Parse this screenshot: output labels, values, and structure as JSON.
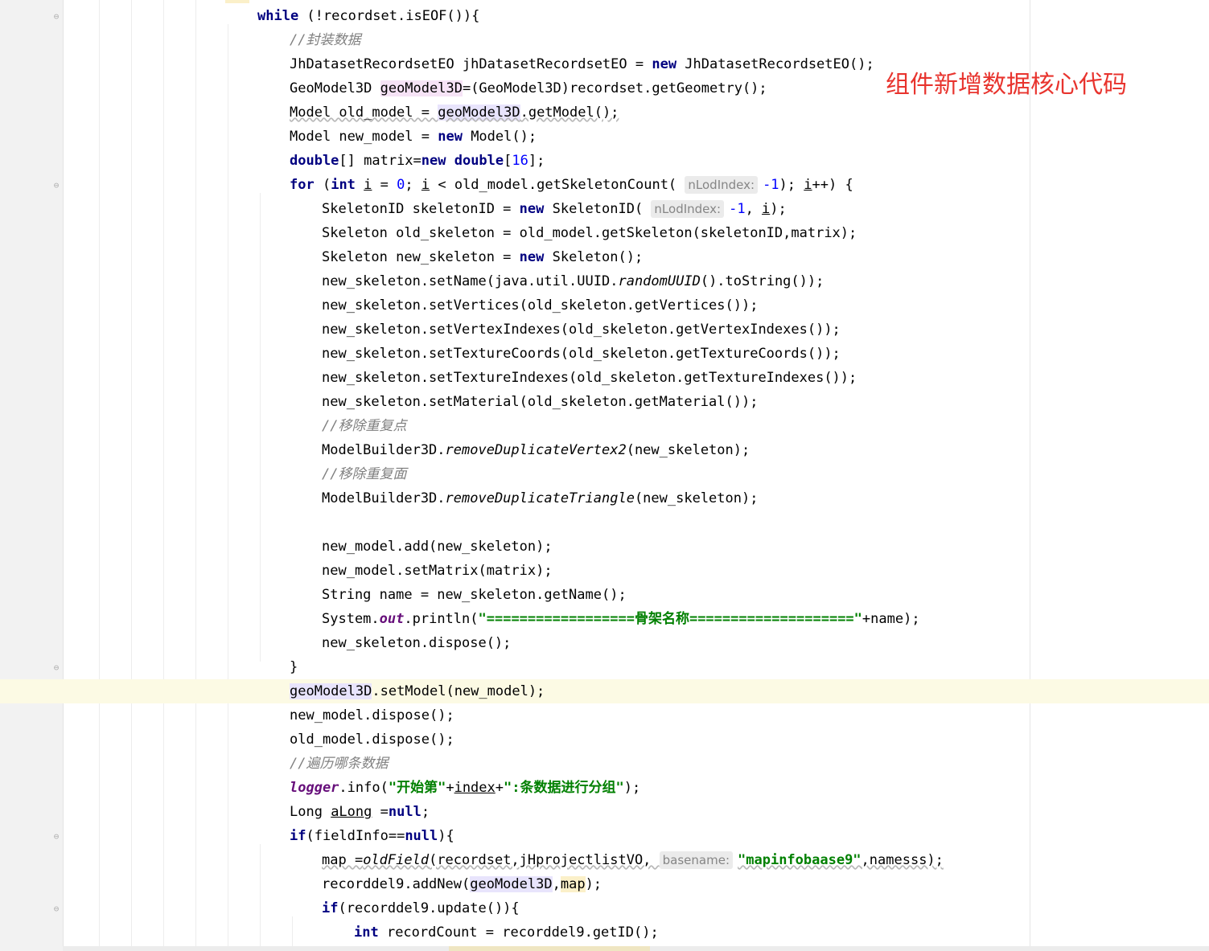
{
  "annotation": "组件新增数据核心代码",
  "colors": {
    "keyword": "#000080",
    "comment": "#808080",
    "string": "#008000",
    "number": "#0000ff",
    "static_field": "#660e7a",
    "annotation": "#e8342e",
    "caret_row": "#fcfae4"
  },
  "lines": [
    {
      "indent": 7,
      "tokens": [
        {
          "t": "while",
          "c": "kw"
        },
        {
          "t": " (!recordset.isEOF()){"
        }
      ]
    },
    {
      "indent": 8,
      "tokens": [
        {
          "t": "//封装数据",
          "c": "cm"
        }
      ]
    },
    {
      "indent": 8,
      "tokens": [
        {
          "t": "JhDatasetRecordsetEO jhDatasetRecordsetEO = "
        },
        {
          "t": "new",
          "c": "kw"
        },
        {
          "t": " JhDatasetRecordsetEO();"
        }
      ]
    },
    {
      "indent": 8,
      "tokens": [
        {
          "t": "GeoModel3D "
        },
        {
          "t": "geoModel3D",
          "c": "hl-p"
        },
        {
          "t": "=(GeoModel3D)recordset.getGeometry();"
        }
      ]
    },
    {
      "indent": 8,
      "tokens": [
        {
          "t": "Model old_model = ",
          "c": "wv"
        },
        {
          "t": "geoModel3D",
          "c": "hl-b wv"
        },
        {
          "t": ".getModel();",
          "c": "wv"
        }
      ]
    },
    {
      "indent": 8,
      "tokens": [
        {
          "t": "Model new_model = "
        },
        {
          "t": "new",
          "c": "kw"
        },
        {
          "t": " Model();"
        }
      ]
    },
    {
      "indent": 8,
      "tokens": [
        {
          "t": "double",
          "c": "kw"
        },
        {
          "t": "[] matrix="
        },
        {
          "t": "new double",
          "c": "kw"
        },
        {
          "t": "["
        },
        {
          "t": "16",
          "c": "num"
        },
        {
          "t": "];"
        }
      ]
    },
    {
      "indent": 8,
      "tokens": [
        {
          "t": "for",
          "c": "kw"
        },
        {
          "t": " ("
        },
        {
          "t": "int",
          "c": "kw"
        },
        {
          "t": " "
        },
        {
          "t": "i",
          "c": "ul"
        },
        {
          "t": " = "
        },
        {
          "t": "0",
          "c": "num"
        },
        {
          "t": "; "
        },
        {
          "t": "i",
          "c": "ul"
        },
        {
          "t": " < old_model.getSkeletonCount( "
        },
        {
          "t": "nLodIndex:",
          "c": "hint"
        },
        {
          "t": "-1",
          "c": "num"
        },
        {
          "t": "); "
        },
        {
          "t": "i",
          "c": "ul"
        },
        {
          "t": "++) {"
        }
      ]
    },
    {
      "indent": 9,
      "tokens": [
        {
          "t": "SkeletonID skeletonID = "
        },
        {
          "t": "new",
          "c": "kw"
        },
        {
          "t": " SkeletonID( "
        },
        {
          "t": "nLodIndex:",
          "c": "hint"
        },
        {
          "t": "-1",
          "c": "num"
        },
        {
          "t": ", "
        },
        {
          "t": "i",
          "c": "ul"
        },
        {
          "t": ");"
        }
      ]
    },
    {
      "indent": 9,
      "tokens": [
        {
          "t": "Skeleton old_skeleton = old_model.getSkeleton(skeletonID,matrix);"
        }
      ]
    },
    {
      "indent": 9,
      "tokens": [
        {
          "t": "Skeleton new_skeleton = "
        },
        {
          "t": "new",
          "c": "kw"
        },
        {
          "t": " Skeleton();"
        }
      ]
    },
    {
      "indent": 9,
      "tokens": [
        {
          "t": "new_skeleton.setName(java.util.UUID."
        },
        {
          "t": "randomUUID",
          "c": "it"
        },
        {
          "t": "().toString());"
        }
      ]
    },
    {
      "indent": 9,
      "tokens": [
        {
          "t": "new_skeleton.setVertices(old_skeleton.getVertices());"
        }
      ]
    },
    {
      "indent": 9,
      "tokens": [
        {
          "t": "new_skeleton.setVertexIndexes(old_skeleton.getVertexIndexes());"
        }
      ]
    },
    {
      "indent": 9,
      "tokens": [
        {
          "t": "new_skeleton.setTextureCoords(old_skeleton.getTextureCoords());"
        }
      ]
    },
    {
      "indent": 9,
      "tokens": [
        {
          "t": "new_skeleton.setTextureIndexes(old_skeleton.getTextureIndexes());"
        }
      ]
    },
    {
      "indent": 9,
      "tokens": [
        {
          "t": "new_skeleton.setMaterial(old_skeleton.getMaterial());"
        }
      ]
    },
    {
      "indent": 9,
      "tokens": [
        {
          "t": "//移除重复点",
          "c": "cm"
        }
      ]
    },
    {
      "indent": 9,
      "tokens": [
        {
          "t": "ModelBuilder3D."
        },
        {
          "t": "removeDuplicateVertex2",
          "c": "it"
        },
        {
          "t": "(new_skeleton);"
        }
      ]
    },
    {
      "indent": 9,
      "tokens": [
        {
          "t": "//移除重复面",
          "c": "cm"
        }
      ]
    },
    {
      "indent": 9,
      "tokens": [
        {
          "t": "ModelBuilder3D."
        },
        {
          "t": "removeDuplicateTriangle",
          "c": "it"
        },
        {
          "t": "(new_skeleton);"
        }
      ]
    },
    {
      "indent": 9,
      "tokens": []
    },
    {
      "indent": 9,
      "tokens": [
        {
          "t": "new_model.add(new_skeleton);"
        }
      ]
    },
    {
      "indent": 9,
      "tokens": [
        {
          "t": "new_model.setMatrix(matrix);"
        }
      ]
    },
    {
      "indent": 9,
      "tokens": [
        {
          "t": "String name = new_skeleton.getName();"
        }
      ]
    },
    {
      "indent": 9,
      "tokens": [
        {
          "t": "System."
        },
        {
          "t": "out",
          "c": "sf"
        },
        {
          "t": ".println("
        },
        {
          "t": "\"==================骨架名称====================\"",
          "c": "str"
        },
        {
          "t": "+name);"
        }
      ]
    },
    {
      "indent": 9,
      "tokens": [
        {
          "t": "new_skeleton.dispose();"
        }
      ]
    },
    {
      "indent": 8,
      "tokens": [
        {
          "t": "}"
        }
      ]
    },
    {
      "indent": 8,
      "tokens": [
        {
          "t": "geoModel3D",
          "c": "hl-b"
        },
        {
          "t": ".setModel(new_model);"
        }
      ]
    },
    {
      "indent": 8,
      "tokens": [
        {
          "t": "new_model.dispose();"
        }
      ]
    },
    {
      "indent": 8,
      "tokens": [
        {
          "t": "old_model.dispose();"
        }
      ]
    },
    {
      "indent": 8,
      "tokens": [
        {
          "t": "//遍历哪条数据",
          "c": "cm"
        }
      ]
    },
    {
      "indent": 8,
      "tokens": [
        {
          "t": "logger",
          "c": "sf"
        },
        {
          "t": ".info("
        },
        {
          "t": "\"开始第\"",
          "c": "str"
        },
        {
          "t": "+"
        },
        {
          "t": "index",
          "c": "ul"
        },
        {
          "t": "+"
        },
        {
          "t": "\":条数据进行分组\"",
          "c": "str"
        },
        {
          "t": ");"
        }
      ]
    },
    {
      "indent": 8,
      "tokens": [
        {
          "t": "Long "
        },
        {
          "t": "aLong",
          "c": "ul"
        },
        {
          "t": " ="
        },
        {
          "t": "null",
          "c": "kw"
        },
        {
          "t": ";"
        }
      ]
    },
    {
      "indent": 8,
      "tokens": [
        {
          "t": "if",
          "c": "kw"
        },
        {
          "t": "(fieldInfo=="
        },
        {
          "t": "null",
          "c": "kw"
        },
        {
          "t": "){"
        }
      ]
    },
    {
      "indent": 9,
      "tokens": [
        {
          "t": "map =",
          "c": "wv"
        },
        {
          "t": "oldField",
          "c": "it wv"
        },
        {
          "t": "(recordset,jHprojectlistVO, ",
          "c": "wv"
        },
        {
          "t": "basename:",
          "c": "hint"
        },
        {
          "t": "\"mapinfobaase9\"",
          "c": "str wv"
        },
        {
          "t": ",namesss);",
          "c": "wv"
        }
      ]
    },
    {
      "indent": 9,
      "tokens": [
        {
          "t": "recorddel9.addNew("
        },
        {
          "t": "geoModel3D",
          "c": "hl-b"
        },
        {
          "t": ","
        },
        {
          "t": "map",
          "c": "hl-y"
        },
        {
          "t": ");"
        }
      ]
    },
    {
      "indent": 9,
      "tokens": [
        {
          "t": "if",
          "c": "kw"
        },
        {
          "t": "(recorddel9.update()){"
        }
      ]
    },
    {
      "indent": 10,
      "tokens": [
        {
          "t": "int",
          "c": "kw"
        },
        {
          "t": " recordCount = recorddel9.getID();"
        }
      ]
    }
  ]
}
